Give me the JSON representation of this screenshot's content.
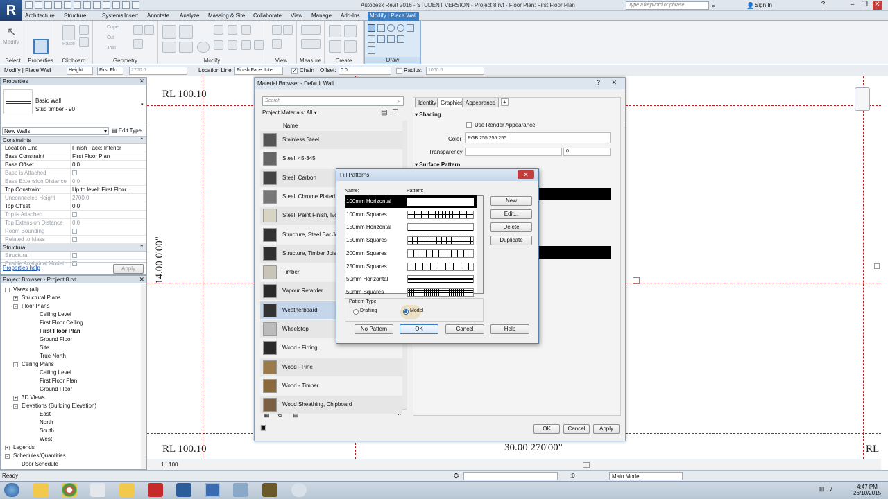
{
  "app": {
    "title": "Autodesk Revit 2016 - STUDENT VERSION -   Project 8.rvt - Floor Plan: First Floor Plan",
    "search_placeholder": "Type a keyword or phrase",
    "sign_in": "Sign In",
    "logo": "R"
  },
  "tabs": [
    "Architecture",
    "Structure",
    "Systems",
    "Insert",
    "Annotate",
    "Analyze",
    "Massing & Site",
    "Collaborate",
    "View",
    "Manage",
    "Add-Ins",
    "Modify | Place Wall"
  ],
  "ribbon": {
    "panels": [
      "Select",
      "Properties",
      "Clipboard",
      "Geometry",
      "Modify",
      "View",
      "Measure",
      "Create",
      "Draw"
    ],
    "modify_label": "Modify",
    "properties_label": "Properties",
    "paste_label": "Paste",
    "cope": "Cope",
    "cut": "Cut",
    "join": "Join"
  },
  "optionbar": {
    "context": "Modify | Place Wall",
    "height_label": "Height",
    "height_target": "First Flc",
    "height_value": "2700.0",
    "location_label": "Location Line:",
    "location_value": "Finish Face: Inte",
    "chain": "Chain",
    "offset_label": "Offset:",
    "offset_value": "0.0",
    "radius_label": "Radius:",
    "radius_value": "1000.0"
  },
  "properties": {
    "title": "Properties",
    "family": "Basic Wall",
    "type": "Stud timber - 90",
    "instance": "New Walls",
    "edit_type": "Edit Type",
    "help": "Properties help",
    "apply": "Apply",
    "sections": [
      "Constraints",
      "Structural"
    ],
    "rows": [
      {
        "k": "Location Line",
        "v": "Finish Face: Interior",
        "dis": false
      },
      {
        "k": "Base Constraint",
        "v": "First Floor Plan",
        "dis": false
      },
      {
        "k": "Base Offset",
        "v": "0.0",
        "dis": false
      },
      {
        "k": "Base is Attached",
        "v": "",
        "dis": true
      },
      {
        "k": "Base Extension Distance",
        "v": "0.0",
        "dis": true
      },
      {
        "k": "Top Constraint",
        "v": "Up to level: First Floor ...",
        "dis": false
      },
      {
        "k": "Unconnected Height",
        "v": "2700.0",
        "dis": true
      },
      {
        "k": "Top Offset",
        "v": "0.0",
        "dis": false
      },
      {
        "k": "Top is Attached",
        "v": "",
        "dis": true
      },
      {
        "k": "Top Extension Distance",
        "v": "0.0",
        "dis": true
      },
      {
        "k": "Room Bounding",
        "v": "",
        "dis": true
      },
      {
        "k": "Related to Mass",
        "v": "",
        "dis": true
      }
    ],
    "structural_rows": [
      {
        "k": "Structural",
        "v": ""
      },
      {
        "k": "Enable Analytical Model",
        "v": ""
      }
    ]
  },
  "browser": {
    "title": "Project Browser - Project 8.rvt",
    "items": [
      {
        "t": "Views (all)",
        "lvl": 0,
        "ex": "-"
      },
      {
        "t": "Structural Plans",
        "lvl": 1,
        "ex": "+"
      },
      {
        "t": "Floor Plans",
        "lvl": 1,
        "ex": "-"
      },
      {
        "t": "Ceiling Level",
        "lvl": 2,
        "ex": ""
      },
      {
        "t": "First Floor Ceiling",
        "lvl": 2,
        "ex": ""
      },
      {
        "t": "First Floor Plan",
        "lvl": 2,
        "ex": "",
        "bold": true
      },
      {
        "t": "Ground Floor",
        "lvl": 2,
        "ex": ""
      },
      {
        "t": "Site",
        "lvl": 2,
        "ex": ""
      },
      {
        "t": "True North",
        "lvl": 2,
        "ex": ""
      },
      {
        "t": "Ceiling Plans",
        "lvl": 1,
        "ex": "-"
      },
      {
        "t": "Ceiling Level",
        "lvl": 2,
        "ex": ""
      },
      {
        "t": "First Floor Plan",
        "lvl": 2,
        "ex": ""
      },
      {
        "t": "Ground Floor",
        "lvl": 2,
        "ex": ""
      },
      {
        "t": "3D Views",
        "lvl": 1,
        "ex": "+"
      },
      {
        "t": "Elevations (Building Elevation)",
        "lvl": 1,
        "ex": "-"
      },
      {
        "t": "East",
        "lvl": 2,
        "ex": ""
      },
      {
        "t": "North",
        "lvl": 2,
        "ex": ""
      },
      {
        "t": "South",
        "lvl": 2,
        "ex": ""
      },
      {
        "t": "West",
        "lvl": 2,
        "ex": ""
      },
      {
        "t": "Legends",
        "lvl": 0,
        "ex": "+"
      },
      {
        "t": "Schedules/Quantities",
        "lvl": 0,
        "ex": "-"
      },
      {
        "t": "Door Schedule",
        "lvl": 1,
        "ex": ""
      }
    ]
  },
  "canvas": {
    "rl_top": "RL 100.10",
    "rl_bottom": "RL 100.10",
    "rl_right": "RL",
    "dim_vertical": "14.00  0'00\"",
    "dim_bottom": "30.00  270'00\"",
    "scale": "1 : 100"
  },
  "matbrowser": {
    "title": "Material Browser - Default Wall",
    "search_placeholder": "Search",
    "filter": "Project Materials: All",
    "col_name": "Name",
    "materials": [
      {
        "name": "Stainless Steel",
        "c": "#555"
      },
      {
        "name": "Steel, 45-345",
        "c": "#666"
      },
      {
        "name": "Steel, Carbon",
        "c": "#444"
      },
      {
        "name": "Steel, Chrome Plated",
        "c": "#777"
      },
      {
        "name": "Steel, Paint Finish, Ivory",
        "c": "#d8d4c4"
      },
      {
        "name": "Structure, Steel Bar Joist",
        "c": "#333"
      },
      {
        "name": "Structure, Timber Joist",
        "c": "#2f2f2f"
      },
      {
        "name": "Timber",
        "c": "#c9c4b8"
      },
      {
        "name": "Vapour Retarder",
        "c": "#2a2a2a"
      },
      {
        "name": "Weatherboard",
        "c": "#333",
        "sel": true
      },
      {
        "name": "Wheelstop",
        "c": "#bbb"
      },
      {
        "name": "Wood - Firring",
        "c": "#2b2b2b"
      },
      {
        "name": "Wood - Pine",
        "c": "#9a7a4a"
      },
      {
        "name": "Wood - Timber",
        "c": "#8a6a3c"
      },
      {
        "name": "Wood Sheathing, Chipboard",
        "c": "#7a6040"
      }
    ],
    "tabs": [
      "Identity",
      "Graphics",
      "Appearance"
    ],
    "shading": "Shading",
    "use_render": "Use Render Appearance",
    "color_label": "Color",
    "color_value": "RGB 255 255 255",
    "transparency_label": "Transparency",
    "transparency_value": "0",
    "surface_pattern": "Surface Pattern",
    "ok": "OK",
    "cancel": "Cancel",
    "apply": "Apply"
  },
  "fillpatterns": {
    "title": "Fill Patterns",
    "col_name": "Name:",
    "col_pattern": "Pattern:",
    "patterns": [
      "100mm Horizontal",
      "100mm Squares",
      "150mm Horizontal",
      "150mm Squares",
      "200mm Squares",
      "250mm Squares",
      "50mm Horizontal",
      "50mm Squares"
    ],
    "selected": 0,
    "buttons": {
      "new": "New",
      "edit": "Edit...",
      "delete": "Delete",
      "duplicate": "Duplicate"
    },
    "pattern_type": "Pattern Type",
    "drafting": "Drafting",
    "model": "Model",
    "no_pattern": "No Pattern",
    "ok": "OK",
    "cancel": "Cancel",
    "help": "Help"
  },
  "status": {
    "text": "Ready",
    "coord": ":0",
    "model": "Main Model"
  },
  "clock": {
    "time": "4:47 PM",
    "date": "26/10/2015"
  }
}
